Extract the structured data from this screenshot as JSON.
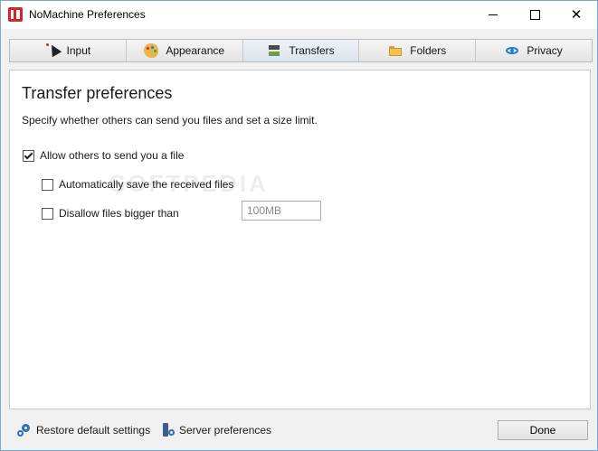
{
  "window": {
    "title": "NoMachine Preferences"
  },
  "tabs": [
    {
      "label": "Input",
      "icon": "cursor-icon",
      "active": false
    },
    {
      "label": "Appearance",
      "icon": "palette-icon",
      "active": false
    },
    {
      "label": "Transfers",
      "icon": "transfer-icon",
      "active": true
    },
    {
      "label": "Folders",
      "icon": "folder-icon",
      "active": false
    },
    {
      "label": "Privacy",
      "icon": "eye-icon",
      "active": false
    }
  ],
  "panel": {
    "heading": "Transfer preferences",
    "description": "Specify whether others can send you files and set a size limit.",
    "options": [
      {
        "label": "Allow others to send you a file",
        "checked": true
      },
      {
        "label": "Automatically save the received files",
        "checked": false
      },
      {
        "label": "Disallow files bigger than",
        "checked": false
      }
    ],
    "size_limit_value": "100MB",
    "watermark": "SOFTPEDIA"
  },
  "footer": {
    "restore_label": "Restore default settings",
    "server_label": "Server preferences",
    "done_label": "Done"
  },
  "colors": {
    "accent": "#2f6db5",
    "brand": "#d4252a"
  }
}
